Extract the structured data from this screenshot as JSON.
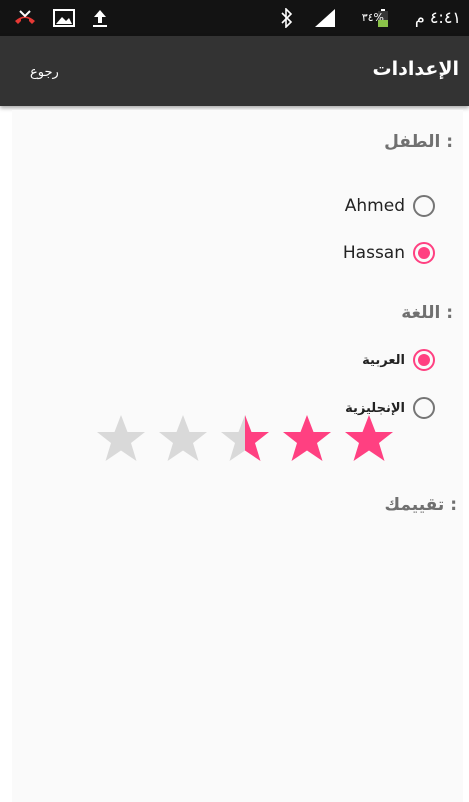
{
  "status_bar": {
    "time": "٤:٤١ م",
    "battery": "٣٤%",
    "icons": [
      "missed-call-icon",
      "image-icon",
      "upload-icon",
      "bluetooth-icon",
      "signal-icon",
      "battery-icon"
    ]
  },
  "toolbar": {
    "title": "الإعدادات",
    "back_label": "رجوع"
  },
  "child_section": {
    "label": "الطفل :",
    "options": [
      {
        "label": "Ahmed",
        "checked": false
      },
      {
        "label": "Hassan",
        "checked": true
      }
    ]
  },
  "language_section": {
    "label": "اللغة :",
    "options": [
      {
        "label": "العربية",
        "checked": true
      },
      {
        "label": "الإنجليزية",
        "checked": false
      }
    ]
  },
  "rating_section": {
    "label": "تقييمك :",
    "max": 5,
    "value": 2.5
  },
  "colors": {
    "accent": "#ff4081",
    "star_empty": "#d9d9d9",
    "toolbar": "#333333",
    "status_bar": "#131313"
  }
}
